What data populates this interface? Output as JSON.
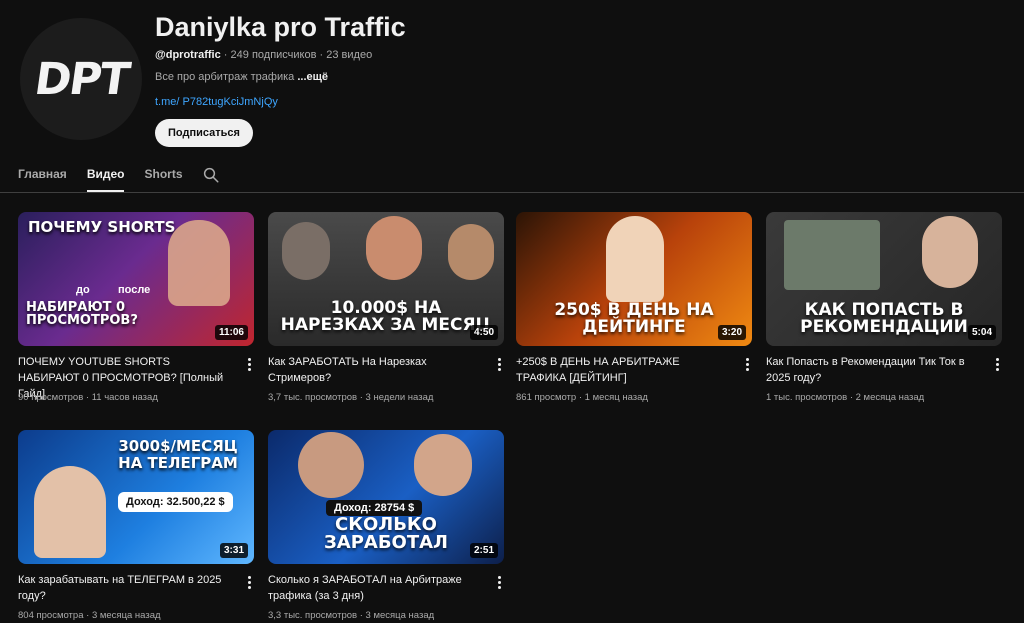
{
  "channel": {
    "avatar_text": "DPT",
    "name": "Daniylka pro Traffic",
    "handle": "@dprotraffic",
    "subscribers": "249 подписчиков",
    "video_count": "23 видео",
    "separator": "·",
    "description": "Все про арбитраж трафика",
    "more_label": "...ещё",
    "link": "t.me/ P782tugKciJmNjQy",
    "subscribe_label": "Подписаться"
  },
  "tabs": [
    "Главная",
    "Видео",
    "Shorts"
  ],
  "active_tab": "Видео",
  "icons": {
    "search": "search-icon",
    "more": "more-vert-icon"
  },
  "colors": {
    "background": "#0f0f0f",
    "link": "#3ea6ff",
    "divider": "#3f3f3f"
  },
  "videos": [
    {
      "title": "ПОЧЕМУ YOUTUBE SHORTS НАБИРАЮТ 0 ПРОСМОТРОВ? [Полный Гайд]",
      "views": "90 просмотров",
      "age": "11 часов назад",
      "duration": "11:06"
    },
    {
      "title": "Как ЗАРАБОТАТЬ На Нарезках Стримеров?",
      "views": "3,7 тыс. просмотров",
      "age": "3 недели назад",
      "duration": "4:50"
    },
    {
      "title": "+250$ В ДЕНЬ НА АРБИТРАЖЕ ТРАФИКА [ДЕЙТИНГ]",
      "views": "861 просмотр",
      "age": "1 месяц назад",
      "duration": "3:20"
    },
    {
      "title": "Как Попасть в Рекомендации Тик Ток в 2025 году?",
      "views": "1 тыс. просмотров",
      "age": "2 месяца назад",
      "duration": "5:04"
    },
    {
      "title": "Как зарабатывать на ТЕЛЕГРАМ в 2025 году?",
      "views": "804 просмотра",
      "age": "3 месяца назад",
      "duration": "3:31"
    },
    {
      "title": "Сколько я ЗАРАБОТАЛ на Арбитраже трафика (за 3 дня)",
      "views": "3,3 тыс. просмотров",
      "age": "3 месяца назад",
      "duration": "2:51"
    }
  ],
  "thumb_texts": [
    {
      "top": "ПОЧЕМУ SHORTS",
      "bottom": "НАБИРАЮТ 0 ПРОСМОТРОВ?",
      "extra1": "до",
      "extra2": "после"
    },
    {
      "top": "",
      "bottom": "10.000$ НА НАРЕЗКАХ ЗА МЕСЯЦ"
    },
    {
      "top": "",
      "bottom": "250$ В ДЕНЬ НА ДЕЙТИНГЕ"
    },
    {
      "top": "",
      "bottom": "КАК ПОПАСТЬ В РЕКОМЕНДАЦИИ"
    },
    {
      "top": "3000$/МЕСЯЦ НА ТЕЛЕГРАМ",
      "bottom": "Доход: 32.500,22 $"
    },
    {
      "top": "Доход: 28754 $",
      "bottom": "СКОЛЬКО ЗАРАБОТАЛ"
    }
  ]
}
